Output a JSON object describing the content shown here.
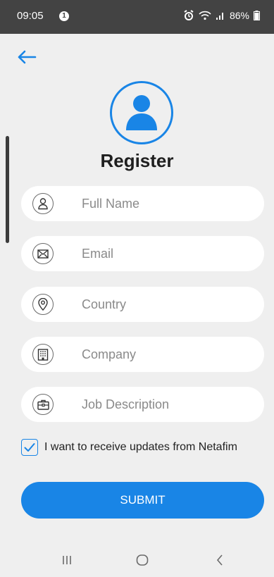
{
  "status_bar": {
    "time": "09:05",
    "notification_count": "1",
    "battery": "86%"
  },
  "page": {
    "title": "Register"
  },
  "fields": [
    {
      "placeholder": "Full Name",
      "icon": "person-icon"
    },
    {
      "placeholder": "Email",
      "icon": "envelope-icon"
    },
    {
      "placeholder": "Country",
      "icon": "location-pin-icon"
    },
    {
      "placeholder": "Company",
      "icon": "building-icon"
    },
    {
      "placeholder": "Job Description",
      "icon": "briefcase-icon"
    }
  ],
  "updates_checkbox": {
    "label": "I want to receive updates from Netafim",
    "checked": true
  },
  "submit": {
    "label": "SUBMIT"
  },
  "colors": {
    "accent": "#1985e6",
    "background": "#efefef",
    "status_bar": "#434343"
  }
}
